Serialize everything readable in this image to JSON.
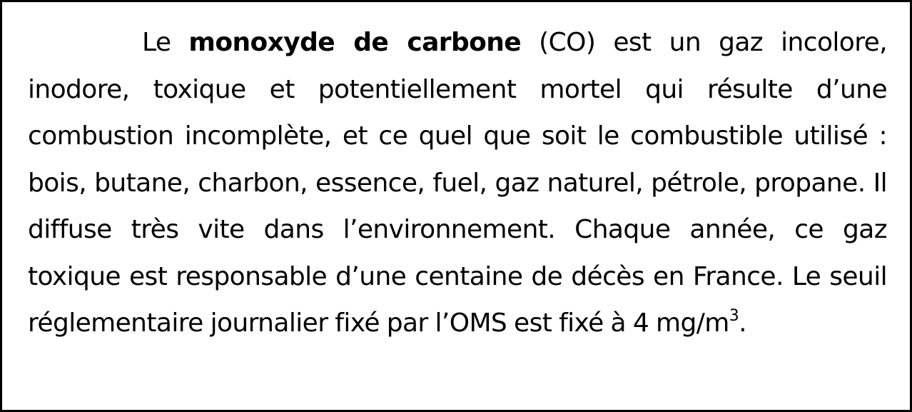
{
  "paragraph": {
    "intro": "Le ",
    "term": "monoxyde de carbone",
    "after_term": " (CO) est un gaz incolore, inodore, toxique et potentiellement mortel qui résulte d’une combustion incomplète, et ce quel que soit le combustible utilisé : bois, butane, charbon, essence, fuel, gaz naturel, pétrole, propane. Il diffuse très vite dans l’environnement. Chaque année, ce gaz toxique est responsable d’une centaine de décès en France. Le seuil réglementaire journalier fixé par l’OMS est fixé à 4 mg/m",
    "unit_exponent": "3",
    "ending": "."
  }
}
